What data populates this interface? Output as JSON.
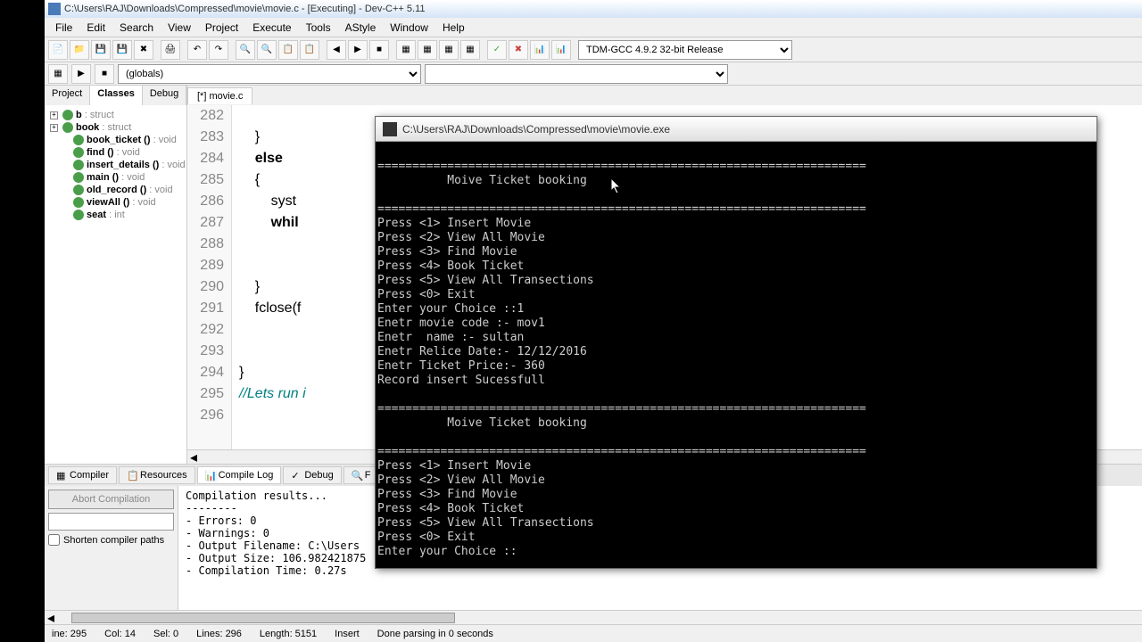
{
  "title": "C:\\Users\\RAJ\\Downloads\\Compressed\\movie\\movie.c - [Executing] - Dev-C++ 5.11",
  "menu": [
    "File",
    "Edit",
    "Search",
    "View",
    "Project",
    "Execute",
    "Tools",
    "AStyle",
    "Window",
    "Help"
  ],
  "compiler_select": "TDM-GCC 4.9.2 32-bit Release",
  "globals_select": "(globals)",
  "left_tabs": [
    "Project",
    "Classes",
    "Debug"
  ],
  "left_tab_active": 1,
  "tree_items": [
    {
      "name": "b",
      "type": ": struct",
      "expand": true
    },
    {
      "name": "book",
      "type": ": struct",
      "expand": true
    },
    {
      "name": "book_ticket ()",
      "type": ": void",
      "indent": true
    },
    {
      "name": "find ()",
      "type": ": void",
      "indent": true
    },
    {
      "name": "insert_details ()",
      "type": ": void",
      "indent": true
    },
    {
      "name": "main ()",
      "type": ": void",
      "indent": true
    },
    {
      "name": "old_record ()",
      "type": ": void",
      "indent": true
    },
    {
      "name": "viewAll ()",
      "type": ": void",
      "indent": true
    },
    {
      "name": "seat",
      "type": ": int",
      "indent": true
    }
  ],
  "file_tab": "[*] movie.c",
  "code_start_line": 282,
  "code_lines": [
    "",
    "    }",
    "    else",
    "    {",
    "        syst",
    "        whil",
    "",
    "",
    "    }",
    "    fclose(f",
    "",
    "",
    "}",
    "//Lets run i",
    ""
  ],
  "bottom_tabs": [
    "Compiler",
    "Resources",
    "Compile Log",
    "Debug",
    "F"
  ],
  "bottom_tab_active": 2,
  "abort_btn": "Abort Compilation",
  "shorten_check": "Shorten compiler paths",
  "compile_log": "Compilation results...\n--------\n- Errors: 0\n- Warnings: 0\n- Output Filename: C:\\Users\n- Output Size: 106.982421875\n- Compilation Time: 0.27s",
  "status": {
    "line": "ine:   295",
    "col": "Col:   14",
    "sel": "Sel:   0",
    "lines": "Lines:   296",
    "length": "Length:   5151",
    "mode": "Insert",
    "parse": "Done parsing in 0 seconds"
  },
  "console": {
    "title": "C:\\Users\\RAJ\\Downloads\\Compressed\\movie\\movie.exe",
    "body": "\n======================================================================\n          Moive Ticket booking\n\n======================================================================\nPress <1> Insert Movie\nPress <2> View All Movie\nPress <3> Find Movie\nPress <4> Book Ticket\nPress <5> View All Transections\nPress <0> Exit\nEnter your Choice ::1\nEnetr movie code :- mov1\nEnetr  name :- sultan\nEnetr Relice Date:- 12/12/2016\nEnetr Ticket Price:- 360\nRecord insert Sucessfull\n\n======================================================================\n          Moive Ticket booking\n\n======================================================================\nPress <1> Insert Movie\nPress <2> View All Movie\nPress <3> Find Movie\nPress <4> Book Ticket\nPress <5> View All Transections\nPress <0> Exit\nEnter your Choice ::"
  },
  "chart_data": null
}
